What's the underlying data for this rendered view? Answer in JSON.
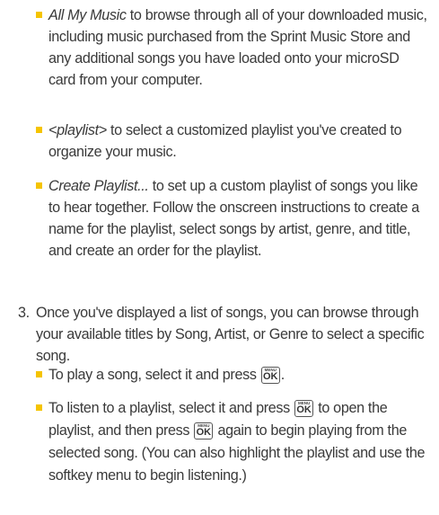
{
  "items": {
    "all_music": {
      "term": "All My Music",
      "text": " to browse through all of your downloaded music, including music purchased from the Sprint Music Store and any additional songs you have loaded onto your microSD card from your computer."
    },
    "playlist_tag": {
      "term": "<playlist>",
      "text": " to select a customized playlist you've created to organize your music."
    },
    "create_playlist": {
      "term": "Create Playlist...",
      "text": " to set up a custom playlist of songs you like to hear together. Follow the onscreen instructions to create a name for the playlist, select songs by artist, genre, and title, and create an order for the playlist."
    }
  },
  "step3": {
    "number": "3.",
    "text": "Once you've displayed a list of songs, you can browse through your available titles by Song, Artist, or Genre to select a specific song."
  },
  "play_song": {
    "text_before": "To play a song, select it and press ",
    "text_after": "."
  },
  "listen_playlist": {
    "text_1": "To listen to a playlist, select it and press ",
    "text_2": " to open the playlist, and then press ",
    "text_3": " again to begin playing from the selected song. (You can also highlight the playlist and use the softkey menu to begin listening.)"
  },
  "menu_key": {
    "top": "MENU",
    "label": "OK"
  },
  "colors": {
    "bullet": "#f5c400",
    "text": "#3a3a3a"
  }
}
